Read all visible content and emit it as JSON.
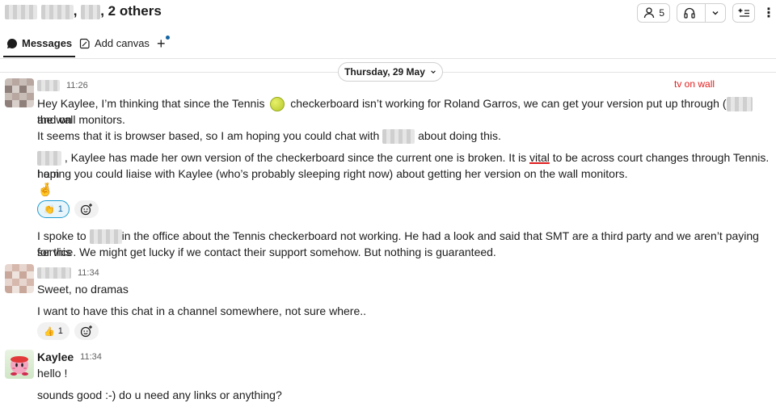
{
  "header": {
    "title_suffix": "2 others",
    "members_count": "5",
    "icons": {
      "members": "people-icon",
      "huddle": "headphones-icon",
      "dropdown": "chevron-down-icon",
      "ai": "sparkle-list-icon",
      "more": "kebab-icon"
    }
  },
  "tabs": {
    "messages": "Messages",
    "canvas": "Add canvas",
    "plus": "+"
  },
  "date_divider": "Thursday, 29 May",
  "annotation": "tv on wall",
  "messages": [
    {
      "time": "11:26",
      "p1_a": "Hey Kaylee, I’m thinking that since the Tennis",
      "p1_b": "checkerboard isn’t working for Roland Garros, we can get your version put up through (",
      "p1_c": "and on",
      "p1_d": "the wall monitors.",
      "p2_a": "It seems that it is browser based, so I am hoping you could chat with",
      "p2_b": "about doing this.",
      "p3_a": ", Kaylee has made her own version of the checkerboard since the current one is broken. It is",
      "p3_vital": "vital",
      "p3_b": "to be across court changes through Tennis. I am",
      "p3_c": "hoping you could liaise with Kaylee (who’s probably sleeping right now) about getting her version on the wall monitors.",
      "emoji_line": "🤞",
      "reaction_emoji": "👏",
      "reaction_count": "1",
      "p4_a": "I spoke to",
      "p4_b": "in the office about the Tennis checkerboard not working. He had a look and said that SMT are a third party and we aren’t paying for this",
      "p4_c": "service. We might get lucky if we contact their support somehow. But nothing is guaranteed."
    },
    {
      "time": "11:34",
      "line1": "Sweet, no dramas",
      "line2": "I want to have this chat in a channel somewhere, not sure where..",
      "reaction_emoji": "👍",
      "reaction_count": "1"
    },
    {
      "name": "Kaylee",
      "time": "11:34",
      "line1": "hello !",
      "line2": "sounds good :-) do u need any links or anything?"
    }
  ]
}
